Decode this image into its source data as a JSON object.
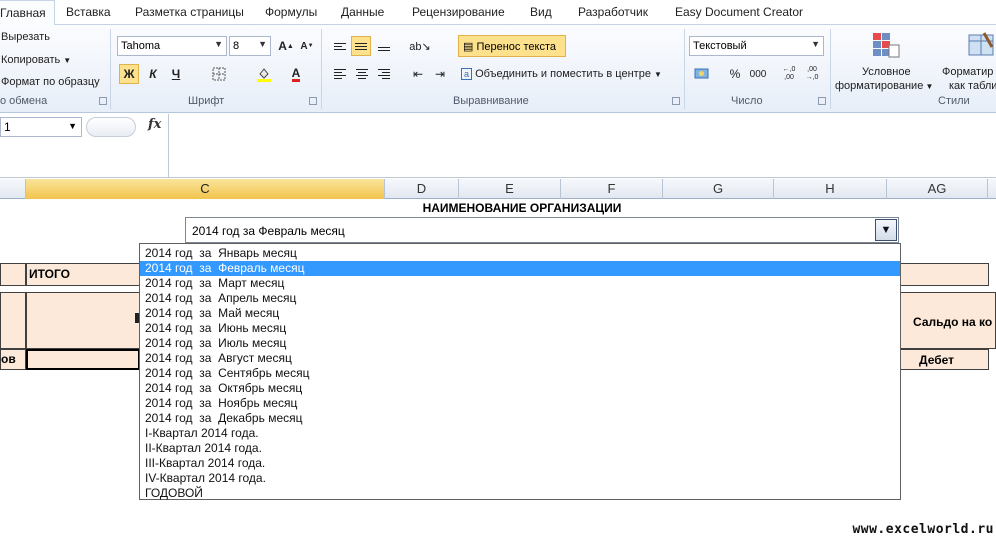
{
  "ribbon_tabs": [
    "Главная",
    "Вставка",
    "Разметка страницы",
    "Формулы",
    "Данные",
    "Рецензирование",
    "Вид",
    "Разработчик",
    "Easy Document Creator"
  ],
  "clipboard": {
    "cut": "Вырезать",
    "copy": "Копировать",
    "format_painter": "Формат по образцу",
    "group": "о обмена"
  },
  "font": {
    "name": "Tahoma",
    "size": "8",
    "bold": "Ж",
    "italic": "К",
    "underline": "Ч",
    "group": "Шрифт"
  },
  "alignment": {
    "wrap": "Перенос текста",
    "merge": "Объединить и поместить в центре",
    "group": "Выравнивание"
  },
  "number": {
    "format": "Текстовый",
    "percent": "%",
    "thousands": "000",
    "inc_decimal": "←,0 ,00",
    "dec_decimal": ",00 →,0",
    "group": "Число"
  },
  "styles": {
    "conditional": "Условное",
    "conditional2": "форматирование",
    "format_table": "Форматир",
    "format_table2": "как табли",
    "group": "Стили"
  },
  "formula_bar": {
    "name_box": "1",
    "fx": "fx",
    "content": ""
  },
  "columns": [
    "C",
    "D",
    "E",
    "F",
    "G",
    "H",
    "AG"
  ],
  "sheet": {
    "title": "НАИМЕНОВАНИЕ ОРГАНИЗАЦИИ",
    "selector_value": "2014 год  за  Февраль месяц",
    "itogo": "ИТОГО",
    "saldo": "Сальдо на ко",
    "debet": "Дебет",
    "ov": "ов"
  },
  "dropdown": {
    "selected_index": 1,
    "options": [
      "2014 год  за  Январь месяц",
      "2014 год  за  Февраль месяц",
      "2014 год  за  Март месяц",
      "2014 год  за  Апрель месяц",
      "2014 год  за  Май месяц",
      "2014 год  за  Июнь месяц",
      "2014 год  за  Июль месяц",
      "2014 год  за  Август месяц",
      "2014 год  за  Сентябрь месяц",
      "2014 год  за  Октябрь месяц",
      "2014 год  за  Ноябрь месяц",
      "2014 год  за  Декабрь месяц",
      "I-Квартал 2014 года.",
      "II-Квартал 2014 года.",
      "III-Квартал 2014 года.",
      "IV-Квартал 2014 года.",
      "ГОДОВОЙ"
    ]
  },
  "watermark": "www.excelworld.ru",
  "colors": {
    "highlight": "#3399ff",
    "pressed": "#fde18c",
    "header_fill": "#fde9d9",
    "selected_col": "#f2c44d"
  }
}
